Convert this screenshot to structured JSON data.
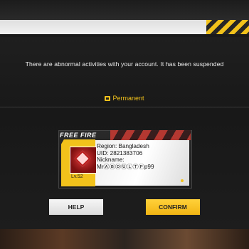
{
  "dialog": {
    "message": "There are abnormal activities with your account. It has been suspended",
    "duration_label": "Permanent",
    "duration_icon": "calendar-icon"
  },
  "card": {
    "brand": "FREE FIRE",
    "region": "Region: Bangladesh",
    "uid": "UID: 2821383706",
    "nickname_label": "Nickname:",
    "nickname_value": "MrⒶⒷⒹⓊⓁⓉⓅp99",
    "level": "Lv.52"
  },
  "buttons": {
    "help": "HELP",
    "confirm": "CONFIRM"
  },
  "colors": {
    "accent": "#f2c21b",
    "background": "#1a1a1a",
    "text": "#f1f1f1"
  }
}
